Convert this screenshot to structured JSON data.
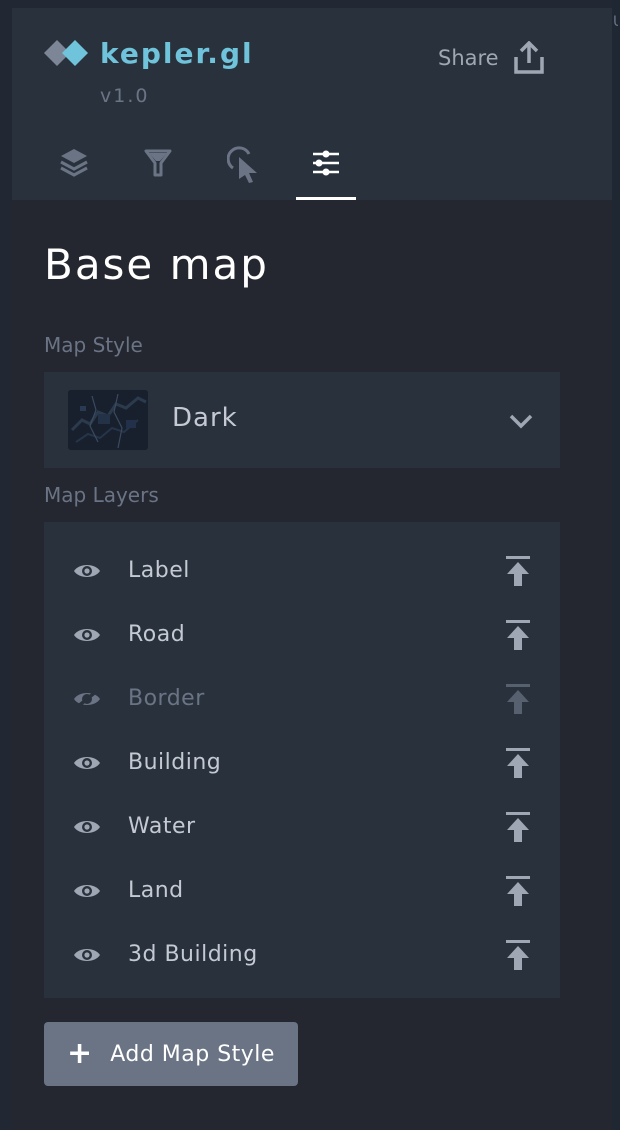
{
  "app": {
    "name": "kepler.gl",
    "version": "v1.0",
    "share_label": "Share"
  },
  "tabs": [
    {
      "icon": "layers-icon",
      "label": "",
      "active": false
    },
    {
      "icon": "filter-icon",
      "label": "",
      "active": false
    },
    {
      "icon": "cursor-icon",
      "label": "",
      "active": false
    },
    {
      "icon": "settings-sliders-icon",
      "label": "",
      "active": true
    }
  ],
  "base_map": {
    "title": "Base map",
    "map_style_label": "Map Style",
    "selected_style": "Dark",
    "map_layers_label": "Map Layers",
    "layers": [
      {
        "label": "Label",
        "visible": true
      },
      {
        "label": "Road",
        "visible": true
      },
      {
        "label": "Border",
        "visible": false
      },
      {
        "label": "Building",
        "visible": true
      },
      {
        "label": "Water",
        "visible": true
      },
      {
        "label": "Land",
        "visible": true
      },
      {
        "label": "3d Building",
        "visible": true
      }
    ],
    "add_style_label": "Add Map Style"
  },
  "colors": {
    "accent": "#6fc3db",
    "panel_bg": "#242730",
    "header_bg": "#29323c",
    "button_bg": "#6a7485"
  }
}
